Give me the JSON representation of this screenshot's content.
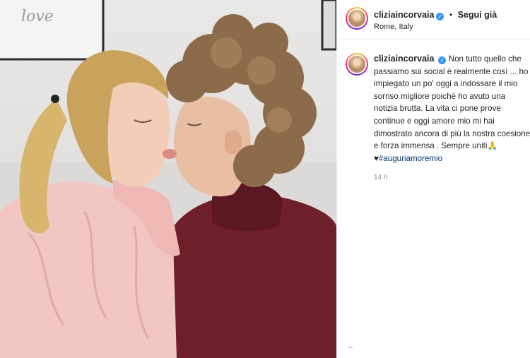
{
  "post": {
    "username": "cliziaincorvaia",
    "location": "Rome, Italy",
    "follow_label": "Segui già",
    "separator": "•"
  },
  "caption": {
    "username": "cliziaincorvaia",
    "text": "Non tutto quello che passiamo sui social è realmente così ... ho impiegato un po' oggi a indossare il mio sorriso migliore poiché ho avuto una notizia brutta. La vita ci pone prove continue e oggi amore mio mi hai dimostrato ancora di più la nostra coesione e forza immensa . Sempre uniti🙏♥",
    "hashtag": "#auguriamoremio",
    "time": "14 h"
  },
  "photo": {
    "frame_text": "love"
  },
  "colors": {
    "verified": "#3897f0",
    "hashtag": "#00376b",
    "blouse": "#f2c6c3",
    "sweater": "#6e1f2a"
  }
}
